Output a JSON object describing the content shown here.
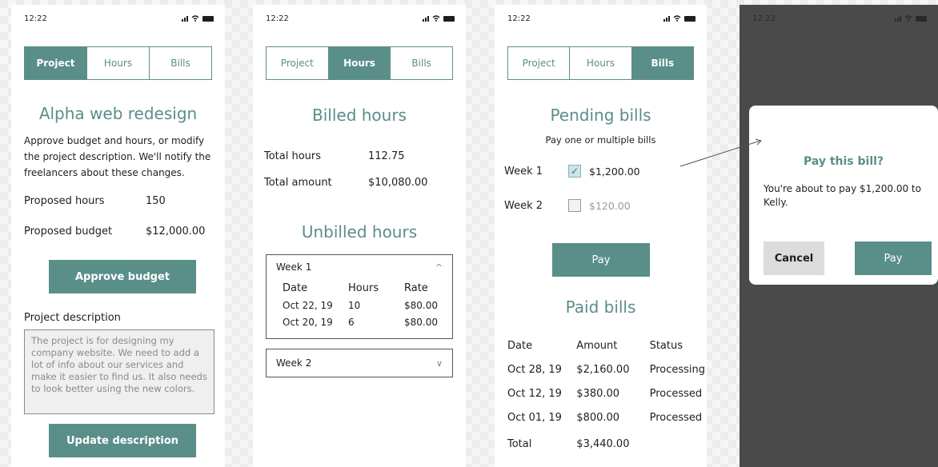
{
  "status_time": "12:22",
  "tabs": [
    "Project",
    "Hours",
    "Bills"
  ],
  "screen1": {
    "title": "Alpha web redesign",
    "intro": "Approve budget and hours, or modify the project description. We'll notify the freelancers about these changes.",
    "proposed_hours_label": "Proposed hours",
    "proposed_hours_value": "150",
    "proposed_budget_label": "Proposed budget",
    "proposed_budget_value": "$12,000.00",
    "approve_button": "Approve budget",
    "description_heading": "Project description",
    "description_text": "The project is for designing my company website. We need to add a lot of info about our services and make it easier to find us. It also needs to look better using the new colors.",
    "update_button": "Update description"
  },
  "screen2": {
    "billed_title": "Billed hours",
    "total_hours_label": "Total hours",
    "total_hours_value": "112.75",
    "total_amount_label": "Total amount",
    "total_amount_value": "$10,080.00",
    "unbilled_title": "Unbilled hours",
    "week1_label": "Week 1",
    "week2_label": "Week 2",
    "columns": [
      "Date",
      "Hours",
      "Rate"
    ],
    "rows": [
      [
        "Oct 22, 19",
        "10",
        "$80.00"
      ],
      [
        "Oct 20, 19",
        "6",
        "$80.00"
      ]
    ]
  },
  "screen3": {
    "pending_title": "Pending bills",
    "pending_sub": "Pay one or multiple bills",
    "week1_label": "Week 1",
    "week1_amount": "$1,200.00",
    "week2_label": "Week 2",
    "week2_amount": "$120.00",
    "check_mark": "✓",
    "pay_button": "Pay",
    "paid_title": "Paid bills",
    "columns": [
      "Date",
      "Amount",
      "Status"
    ],
    "rows": [
      [
        "Oct 28, 19",
        "$2,160.00",
        "Processing"
      ],
      [
        "Oct 12, 19",
        "$380.00",
        "Processed"
      ],
      [
        "Oct 01, 19",
        "$800.00",
        "Processed"
      ]
    ],
    "total_label": "Total",
    "total_value": "$3,440.00"
  },
  "screen4": {
    "modal_title": "Pay this bill?",
    "modal_text": "You're about to pay $1,200.00 to Kelly.",
    "cancel_button": "Cancel",
    "pay_button": "Pay"
  },
  "colors": {
    "accent": "#5a8e89",
    "overlay": "#4a4a4a"
  }
}
